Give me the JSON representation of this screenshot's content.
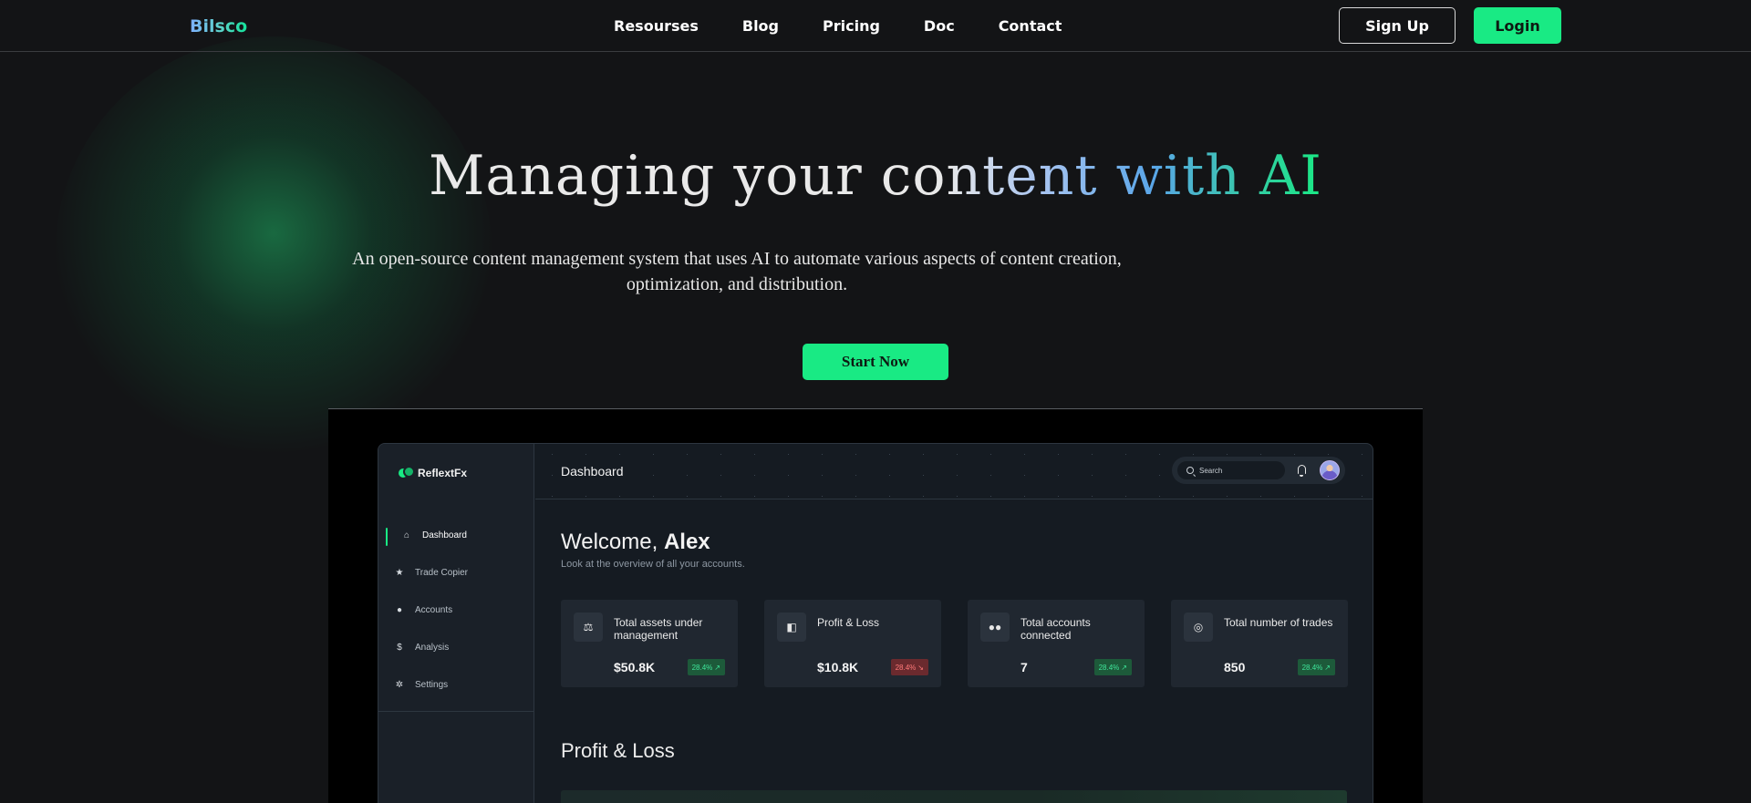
{
  "nav": {
    "logo": "Bilsco",
    "links": [
      "Resourses",
      "Blog",
      "Pricing",
      "Doc",
      "Contact"
    ],
    "signup_label": "Sign Up",
    "login_label": "Login"
  },
  "hero": {
    "title_plain": "Managing your co",
    "title_gradient": "ntent with AI",
    "subtitle": "An open-source content management system that uses AI to automate various aspects of content creation, optimization, and distribution.",
    "cta_label": "Start Now"
  },
  "colors": {
    "accent": "#19ea84",
    "background": "#131416",
    "app_bg": "#151b22"
  },
  "app": {
    "brand": "ReflextFx",
    "sidebar": [
      {
        "label": "Dashboard",
        "icon": "home-icon",
        "active": true
      },
      {
        "label": "Trade Copier",
        "icon": "star-icon",
        "active": false
      },
      {
        "label": "Accounts",
        "icon": "user-icon",
        "active": false
      },
      {
        "label": "Analysis",
        "icon": "dollar-icon",
        "active": false
      },
      {
        "label": "Settings",
        "icon": "gear-icon",
        "active": false
      }
    ],
    "topbar_title": "Dashboard",
    "search_placeholder": "Search",
    "welcome_prefix": "Welcome,",
    "welcome_name": "Alex",
    "welcome_sub": "Look at the overview of all your accounts.",
    "stats": [
      {
        "label": "Total assets under management",
        "value": "$50.8K",
        "badge": "28.4%",
        "trend": "up",
        "icon": "scale-icon"
      },
      {
        "label": "Profit & Loss",
        "value": "$10.8K",
        "badge": "28.4%",
        "trend": "down",
        "icon": "tag-icon"
      },
      {
        "label": "Total accounts connected",
        "value": "7",
        "badge": "28.4%",
        "trend": "up",
        "icon": "users-icon"
      },
      {
        "label": "Total number of trades",
        "value": "850",
        "badge": "28.4%",
        "trend": "up",
        "icon": "coin-icon"
      }
    ],
    "section_title": "Profit & Loss"
  }
}
